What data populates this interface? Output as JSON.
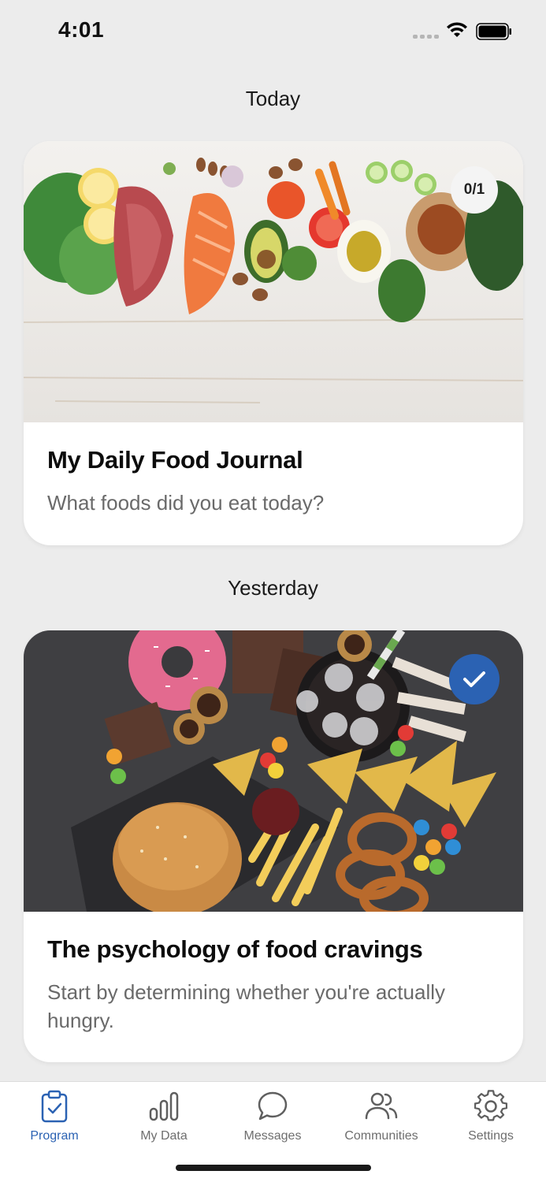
{
  "status_bar": {
    "time": "4:01"
  },
  "sections": {
    "today": {
      "heading": "Today",
      "card": {
        "title": "My Daily Food Journal",
        "subtitle": "What foods did you eat today?",
        "progress": "0/1"
      }
    },
    "yesterday": {
      "heading": "Yesterday",
      "card": {
        "title": "The psychology of food cravings",
        "subtitle": "Start by determining whether you're actually hungry."
      }
    }
  },
  "tab_bar": {
    "tabs": [
      {
        "label": "Program",
        "icon": "clipboard-check-icon",
        "active": true
      },
      {
        "label": "My Data",
        "icon": "bar-chart-icon",
        "active": false
      },
      {
        "label": "Messages",
        "icon": "chat-bubble-icon",
        "active": false
      },
      {
        "label": "Communities",
        "icon": "people-icon",
        "active": false
      },
      {
        "label": "Settings",
        "icon": "gear-icon",
        "active": false
      }
    ]
  },
  "colors": {
    "accent": "#2b62b3",
    "background": "#ececec",
    "card": "#ffffff"
  }
}
